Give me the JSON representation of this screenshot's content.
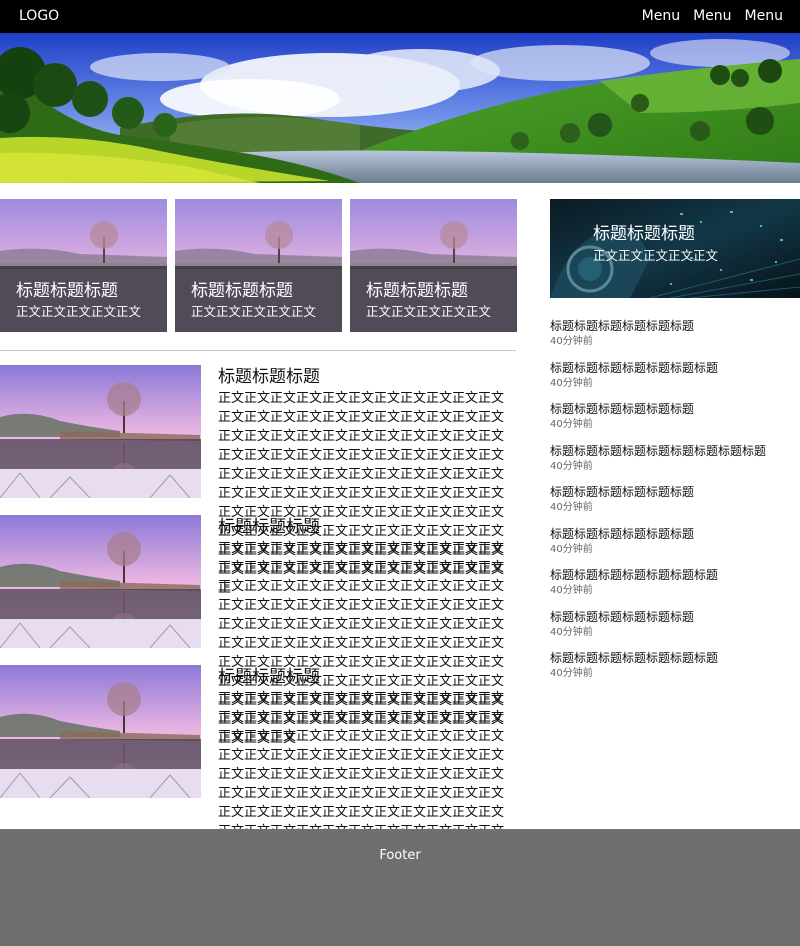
{
  "header": {
    "logo": "LOGO",
    "menu": [
      "Menu",
      "Menu",
      "Menu"
    ]
  },
  "cards": [
    {
      "title": "标题标题标题",
      "body": "正文正文正文正文正文"
    },
    {
      "title": "标题标题标题",
      "body": "正文正文正文正文正文"
    },
    {
      "title": "标题标题标题",
      "body": "正文正文正文正文正文"
    }
  ],
  "articles": [
    {
      "title": "标题标题标题",
      "body": "正文正文正文正文正文正文正文正文正文正文正文正文正文正文正文正文正文正文正文正文正文正文正文正文正文正文正文正文正文正文正文正文正文正文正文正文正文正文正文正文正文正文正文正文正文正文正文正文正文正文正文正文正文正文正文正文正文正文正文正文正文正文正文正文正文正文正文正文正文正文正文正文正文正文正文正文正文正文正文正文正文正文正文正文正文正文正文正文正文正文正文正文正文正文正文正文正文正文正文正文正文正文正文正文正文正文正文正文正文正文正"
    },
    {
      "title": "标题标题标题",
      "body": "正文正文正文正文正文正文正文正文正文正文正文正文正文正文正文正文正文正文正文正文正文正文正文正文正文正文正文正文正文正文正文正文正文正文正文正文正文正文正文正文正文正文正文正文正文正文正文正文正文正文正文正文正文正文正文正文正文正文正文正文正文正文正文正文正文正文正文正文正文正文正文正文正文正文正文正文正文正文正文正文正文正文正文正文正文正文正文正文正文正文正文正文正文正文正文正文正文正文正文正文正文正文正文正文正文正文正文正文正文正文正文正文正文"
    },
    {
      "title": "标题标题标题",
      "body": "正文正文正文正文正文正文正文正文正文正文正文正文正文正文正文正文正文正文正文正文正文正文正文正文正文正文正文正文正文正文正文正文正文正文正文正文正文正文正文正文正文正文正文正文正文正文正文正文正文正文正文正文正文正文正文正文正文正文正文正文正文正文正文正文正文正文正文正文正文正文正文正文正文正文正文正文正文正文正文正文正文正文正文正文正文正文正文正文正文正文正文正文正文正文正文正文正文正文正文正文正文正文正文正文正文正文正文正文正文正文正文正文正文"
    }
  ],
  "feature": {
    "title": "标题标题标题",
    "body": "正文正文正文正文正文"
  },
  "news": [
    {
      "title": "标题标题标题标题标题标题",
      "time": "40分钟前"
    },
    {
      "title": "标题标题标题标题标题标题标题",
      "time": "40分钟前"
    },
    {
      "title": "标题标题标题标题标题标题",
      "time": "40分钟前"
    },
    {
      "title": "标题标题标题标题标题标题标题标题标题",
      "time": "40分钟前"
    },
    {
      "title": "标题标题标题标题标题标题",
      "time": "40分钟前"
    },
    {
      "title": "标题标题标题标题标题标题",
      "time": "40分钟前"
    },
    {
      "title": "标题标题标题标题标题标题标题",
      "time": "40分钟前"
    },
    {
      "title": "标题标题标题标题标题标题",
      "time": "40分钟前"
    },
    {
      "title": "标题标题标题标题标题标题标题",
      "time": "40分钟前"
    }
  ],
  "footer": {
    "text": "Footer"
  },
  "icons": {
    "hero": "landscape-image",
    "thumb": "lake-tree-image",
    "feature": "tech-image"
  }
}
